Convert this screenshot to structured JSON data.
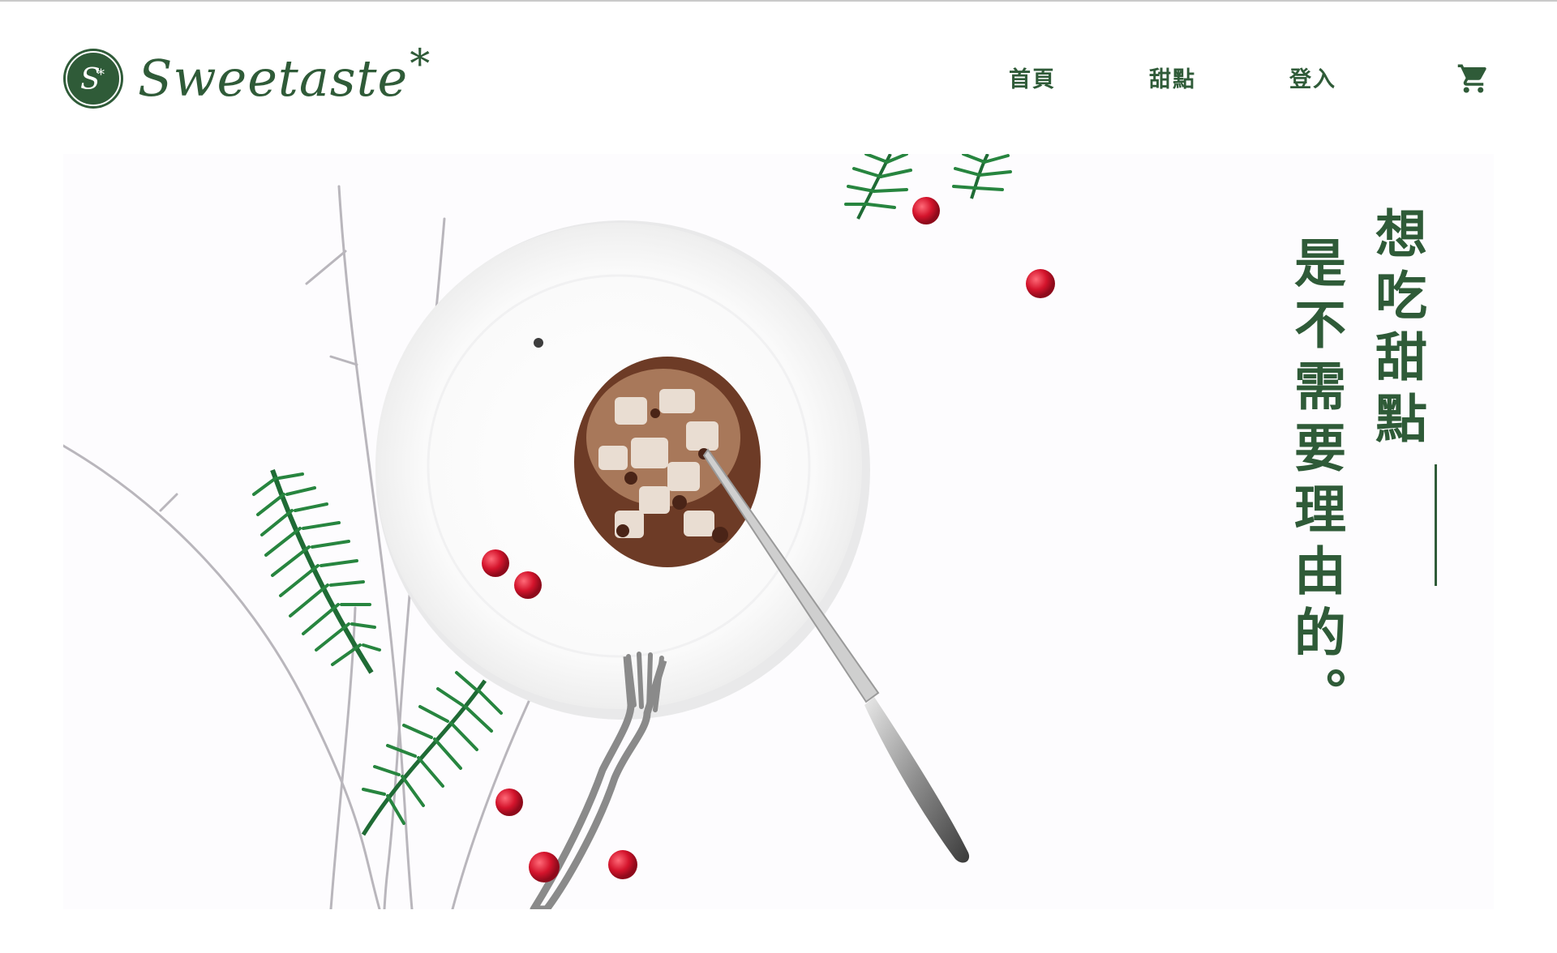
{
  "header": {
    "brand": "Sweetaste",
    "brand_mark": "*",
    "nav": [
      {
        "label": "首頁"
      },
      {
        "label": "甜點"
      },
      {
        "label": "登入"
      }
    ],
    "cart_icon": "shopping-cart-icon"
  },
  "hero": {
    "tagline_line1": "想吃甜點",
    "tagline_line2": "是不需要理由的。"
  },
  "colors": {
    "brand_green": "#2f5b38",
    "berry_red": "#c8102e",
    "background": "#ffffff"
  }
}
